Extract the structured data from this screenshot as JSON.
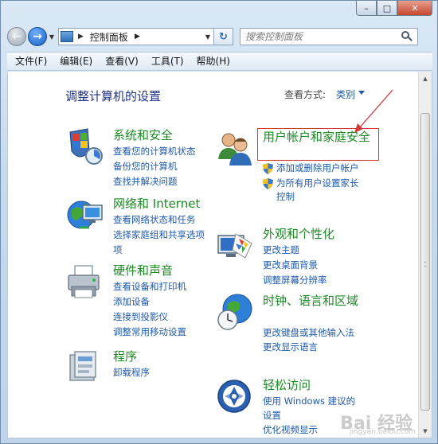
{
  "window": {
    "caption": {
      "minimize": "–",
      "maximize": "□",
      "close": "✕"
    }
  },
  "nav": {
    "back": "←",
    "forward": "→",
    "address_root_sep": "▶",
    "address": "控制面板",
    "address_sep": "▶",
    "refresh": "↻",
    "search_placeholder": "搜索控制面板"
  },
  "menu": [
    "文件(F)",
    "编辑(E)",
    "查看(V)",
    "工具(T)",
    "帮助(H)"
  ],
  "main": {
    "title": "调整计算机的设置",
    "view_label": "查看方式:",
    "view_value": "类别"
  },
  "categories_left": [
    {
      "title": "系统和安全",
      "icon": "system-security-icon",
      "links": [
        "查看您的计算机状态",
        "备份您的计算机",
        "查找并解决问题"
      ]
    },
    {
      "title": "网络和 Internet",
      "icon": "network-globe-icon",
      "links": [
        "查看网络状态和任务",
        "选择家庭组和共享选项"
      ]
    },
    {
      "title": "硬件和声音",
      "icon": "printer-icon",
      "links": [
        "查看设备和打印机",
        "添加设备",
        "连接到投影仪",
        "调整常用移动设置"
      ]
    },
    {
      "title": "程序",
      "icon": "programs-icon",
      "links": [
        "卸载程序"
      ]
    }
  ],
  "categories_right": [
    {
      "title": "用户帐户和家庭安全",
      "icon": "users-icon",
      "shield_links": [
        "添加或删除用户帐户",
        "为所有用户设置家长控制"
      ]
    },
    {
      "title": "外观和个性化",
      "icon": "appearance-icon",
      "links": [
        "更改主题",
        "更改桌面背景",
        "调整屏幕分辨率"
      ]
    },
    {
      "title": "时钟、语言和区域",
      "icon": "clock-globe-icon",
      "links": [
        "更改键盘或其他输入法",
        "更改显示语言"
      ]
    },
    {
      "title": "轻松访问",
      "icon": "ease-access-icon",
      "links": [
        "使用 Windows 建议的设置",
        "优化视频显示"
      ]
    }
  ],
  "watermark": {
    "brand": "Bai 经验",
    "sub": "jingyan.baidu.com"
  },
  "colors": {
    "link": "#1e5aa8",
    "category": "#1b8a23",
    "title": "#1e3287",
    "highlight": "#d23a3a"
  }
}
